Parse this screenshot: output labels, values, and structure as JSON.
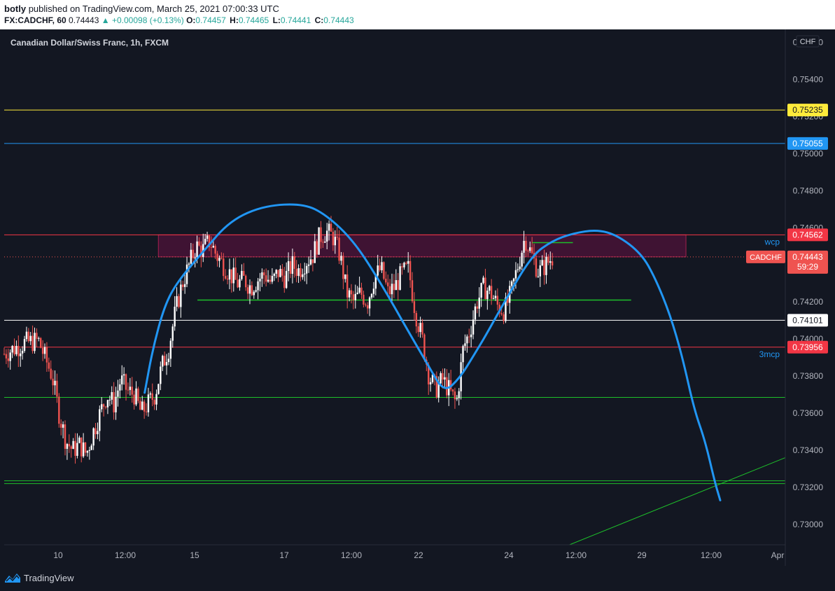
{
  "header": {
    "author": "botly",
    "published_text": "published on TradingView.com, March 25, 2021 07:00:33 UTC",
    "symbol": "FX:CADCHF, 60",
    "last": "0.74443",
    "change": "▲ +0.00098 (+0.13%)",
    "o_label": "O:",
    "o_value": "0.74457",
    "h_label": "H:",
    "h_value": "0.74465",
    "l_label": "L:",
    "l_value": "0.74441",
    "c_label": "C:",
    "c_value": "0.74443"
  },
  "footer": {
    "brand": "TradingView"
  },
  "colors": {
    "background": "#131722",
    "up": "#ffffff",
    "down": "#ef5350",
    "yellow": "#ffeb3b",
    "blue": "#2196f3",
    "green": "#1dbf2a",
    "red": "#f23645",
    "curve": "#2196f3"
  },
  "chart_data": {
    "type": "candlestick",
    "title": "Canadian Dollar/Swiss Franc, 1h, FXCM",
    "currency": "CHF",
    "ylim": [
      0.7289,
      0.7567
    ],
    "y_ticks": [
      "0.73000",
      "0.73200",
      "0.73400",
      "0.73600",
      "0.73800",
      "0.74000",
      "0.74200",
      "0.74400",
      "0.74600",
      "0.74800",
      "0.75000",
      "0.75200",
      "0.75400",
      "0.75600"
    ],
    "x_ticks": [
      "10",
      "12:00",
      "15",
      "17",
      "12:00",
      "22",
      "24",
      "12:00",
      "29",
      "12:00",
      "Apr"
    ],
    "last_price": {
      "label": "CADCHF",
      "value": "0.74443",
      "countdown": "59:29"
    },
    "price_path": [
      [
        0,
        0.7392
      ],
      [
        3,
        0.7398
      ],
      [
        5,
        0.7399
      ],
      [
        7,
        0.738
      ],
      [
        8,
        0.736
      ],
      [
        9,
        0.7345
      ],
      [
        10,
        0.734
      ],
      [
        11,
        0.7343
      ],
      [
        12,
        0.7338
      ],
      [
        13,
        0.735
      ],
      [
        14,
        0.736
      ],
      [
        15,
        0.737
      ],
      [
        16,
        0.7365
      ],
      [
        17,
        0.7378
      ],
      [
        18,
        0.7372
      ],
      [
        19,
        0.737
      ],
      [
        20,
        0.736
      ],
      [
        21,
        0.7365
      ],
      [
        22,
        0.737
      ],
      [
        23,
        0.7385
      ],
      [
        24,
        0.7395
      ],
      [
        25,
        0.7415
      ],
      [
        26,
        0.743
      ],
      [
        27,
        0.744
      ],
      [
        28,
        0.745
      ],
      [
        29,
        0.7448
      ],
      [
        30,
        0.7453
      ],
      [
        31,
        0.7445
      ],
      [
        32,
        0.744
      ],
      [
        33,
        0.7435
      ],
      [
        34,
        0.743
      ],
      [
        35,
        0.7432
      ],
      [
        36,
        0.7428
      ],
      [
        37,
        0.7432
      ],
      [
        38,
        0.7435
      ],
      [
        39,
        0.743
      ],
      [
        40,
        0.7436
      ],
      [
        41,
        0.7433
      ],
      [
        42,
        0.744
      ],
      [
        43,
        0.7437
      ],
      [
        44,
        0.7442
      ],
      [
        45,
        0.7445
      ],
      [
        46,
        0.7455
      ],
      [
        47,
        0.7458
      ],
      [
        48,
        0.7455
      ],
      [
        49,
        0.7445
      ],
      [
        50,
        0.7425
      ],
      [
        51,
        0.742
      ],
      [
        52,
        0.7425
      ],
      [
        53,
        0.742
      ],
      [
        54,
        0.7433
      ],
      [
        55,
        0.7438
      ],
      [
        56,
        0.7425
      ],
      [
        57,
        0.7428
      ],
      [
        58,
        0.7435
      ],
      [
        59,
        0.7438
      ],
      [
        60,
        0.7415
      ],
      [
        61,
        0.74
      ],
      [
        62,
        0.738
      ],
      [
        63,
        0.7373
      ],
      [
        64,
        0.7378
      ],
      [
        65,
        0.7372
      ],
      [
        66,
        0.7365
      ],
      [
        67,
        0.7395
      ],
      [
        68,
        0.7405
      ],
      [
        69,
        0.742
      ],
      [
        70,
        0.7428
      ],
      [
        71,
        0.7425
      ],
      [
        72,
        0.7418
      ],
      [
        73,
        0.7415
      ],
      [
        74,
        0.7425
      ],
      [
        75,
        0.744
      ],
      [
        76,
        0.7455
      ],
      [
        77,
        0.7445
      ],
      [
        78,
        0.7436
      ],
      [
        79,
        0.744
      ],
      [
        80,
        0.7444
      ]
    ],
    "x_domain": [
      0,
      114
    ],
    "horizontal_levels": [
      {
        "price": 0.75235,
        "color": "yellow",
        "label": "0.75235"
      },
      {
        "price": 0.75055,
        "color": "blue",
        "label": "0.75055"
      },
      {
        "price": 0.74562,
        "color": "red",
        "label": "0.74562",
        "note": "wcp"
      },
      {
        "price": 0.74101,
        "color": "white",
        "label": "0.74101"
      },
      {
        "price": 0.73956,
        "color": "red",
        "label": "0.73956",
        "note": "3mcp"
      },
      {
        "price": 0.73685,
        "color": "green"
      },
      {
        "price": 0.73235,
        "color": "green"
      },
      {
        "price": 0.7322,
        "color": "green"
      }
    ],
    "short_levels": [
      {
        "price": 0.7421,
        "x_start": 28.2,
        "x_end": 91.5,
        "color": "green"
      },
      {
        "price": 0.7452,
        "x_start": 77,
        "x_end": 83,
        "color": "green"
      }
    ],
    "zone": {
      "x_start": 22.5,
      "x_end": 99.5,
      "price_top": 0.74562,
      "price_bottom": 0.74443
    },
    "trendline": [
      [
        82.5,
        0.7289
      ],
      [
        114,
        0.7336
      ]
    ],
    "projection_curve": [
      [
        20.5,
        0.7371
      ],
      [
        21.7,
        0.7395
      ],
      [
        23.4,
        0.7418
      ],
      [
        25.3,
        0.7431
      ],
      [
        29,
        0.7447
      ],
      [
        33,
        0.7464
      ],
      [
        38,
        0.7472
      ],
      [
        43.7,
        0.7473
      ],
      [
        47,
        0.7467
      ],
      [
        51,
        0.7453
      ],
      [
        55,
        0.743
      ],
      [
        59,
        0.7404
      ],
      [
        62,
        0.7385
      ],
      [
        64.2,
        0.7371
      ],
      [
        66.5,
        0.7379
      ],
      [
        68.5,
        0.7391
      ],
      [
        70.3,
        0.7402
      ],
      [
        73,
        0.742
      ],
      [
        77,
        0.7445
      ],
      [
        80,
        0.7453
      ],
      [
        83,
        0.7457
      ],
      [
        86.5,
        0.7459
      ],
      [
        89.5,
        0.7456
      ],
      [
        93,
        0.7446
      ],
      [
        95,
        0.7433
      ],
      [
        97.2,
        0.7413
      ],
      [
        99,
        0.739
      ],
      [
        100.7,
        0.7362
      ],
      [
        102.3,
        0.7345
      ],
      [
        103.7,
        0.7323
      ],
      [
        104.5,
        0.7313
      ]
    ]
  }
}
